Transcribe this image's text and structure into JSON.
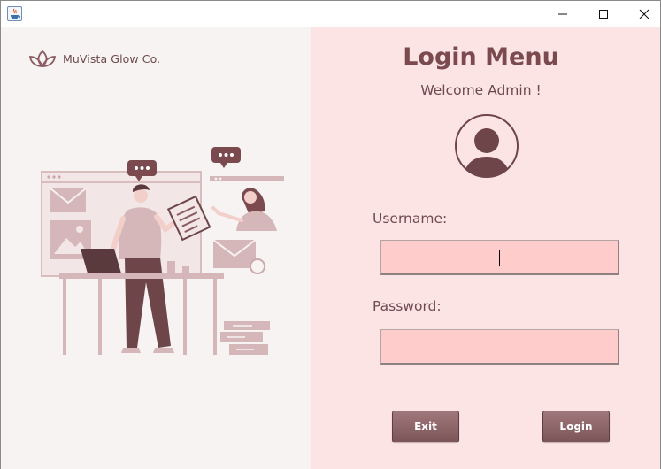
{
  "window": {
    "icon": "java-app-icon",
    "controls": [
      "minimize-icon",
      "maximize-icon",
      "close-icon"
    ]
  },
  "brand": {
    "name": "MuVista Glow Co.",
    "logo": "lotus-logo-icon"
  },
  "login": {
    "title": "Login Menu",
    "welcome": "Welcome Admin !",
    "avatar_icon": "user-avatar-icon",
    "username_label": "Username:",
    "username_value": "",
    "password_label": "Password:",
    "password_value": "",
    "exit_label": "Exit",
    "login_label": "Login"
  },
  "colors": {
    "left_panel_bg": "#f7f3f2",
    "right_panel_bg": "#fde4e4",
    "accent": "#7a4a4f",
    "input_bg": "#fdcccb",
    "button_bg": "#8c6468"
  }
}
